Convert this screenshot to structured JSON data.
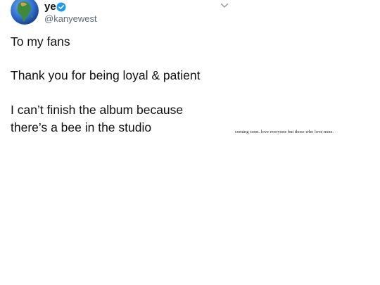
{
  "tweet": {
    "author": {
      "display_name": "ye",
      "handle": "@kanyewest",
      "verified": true,
      "avatar_icon": "globe-icon"
    },
    "menu_icon": "chevron-down-icon",
    "lines": [
      "To my fans",
      "Thank you for being loyal & patient",
      "I can’t finish the album because",
      "there’s a bee in the studio"
    ]
  },
  "caption": "coming soon. love everyone but those who love none.",
  "colors": {
    "verified_badge": "#1d9bf0",
    "handle_text": "#606b76",
    "body_text": "#111111",
    "globe_ocean": "#2f6fd0",
    "globe_land": "#3d8a3a"
  }
}
